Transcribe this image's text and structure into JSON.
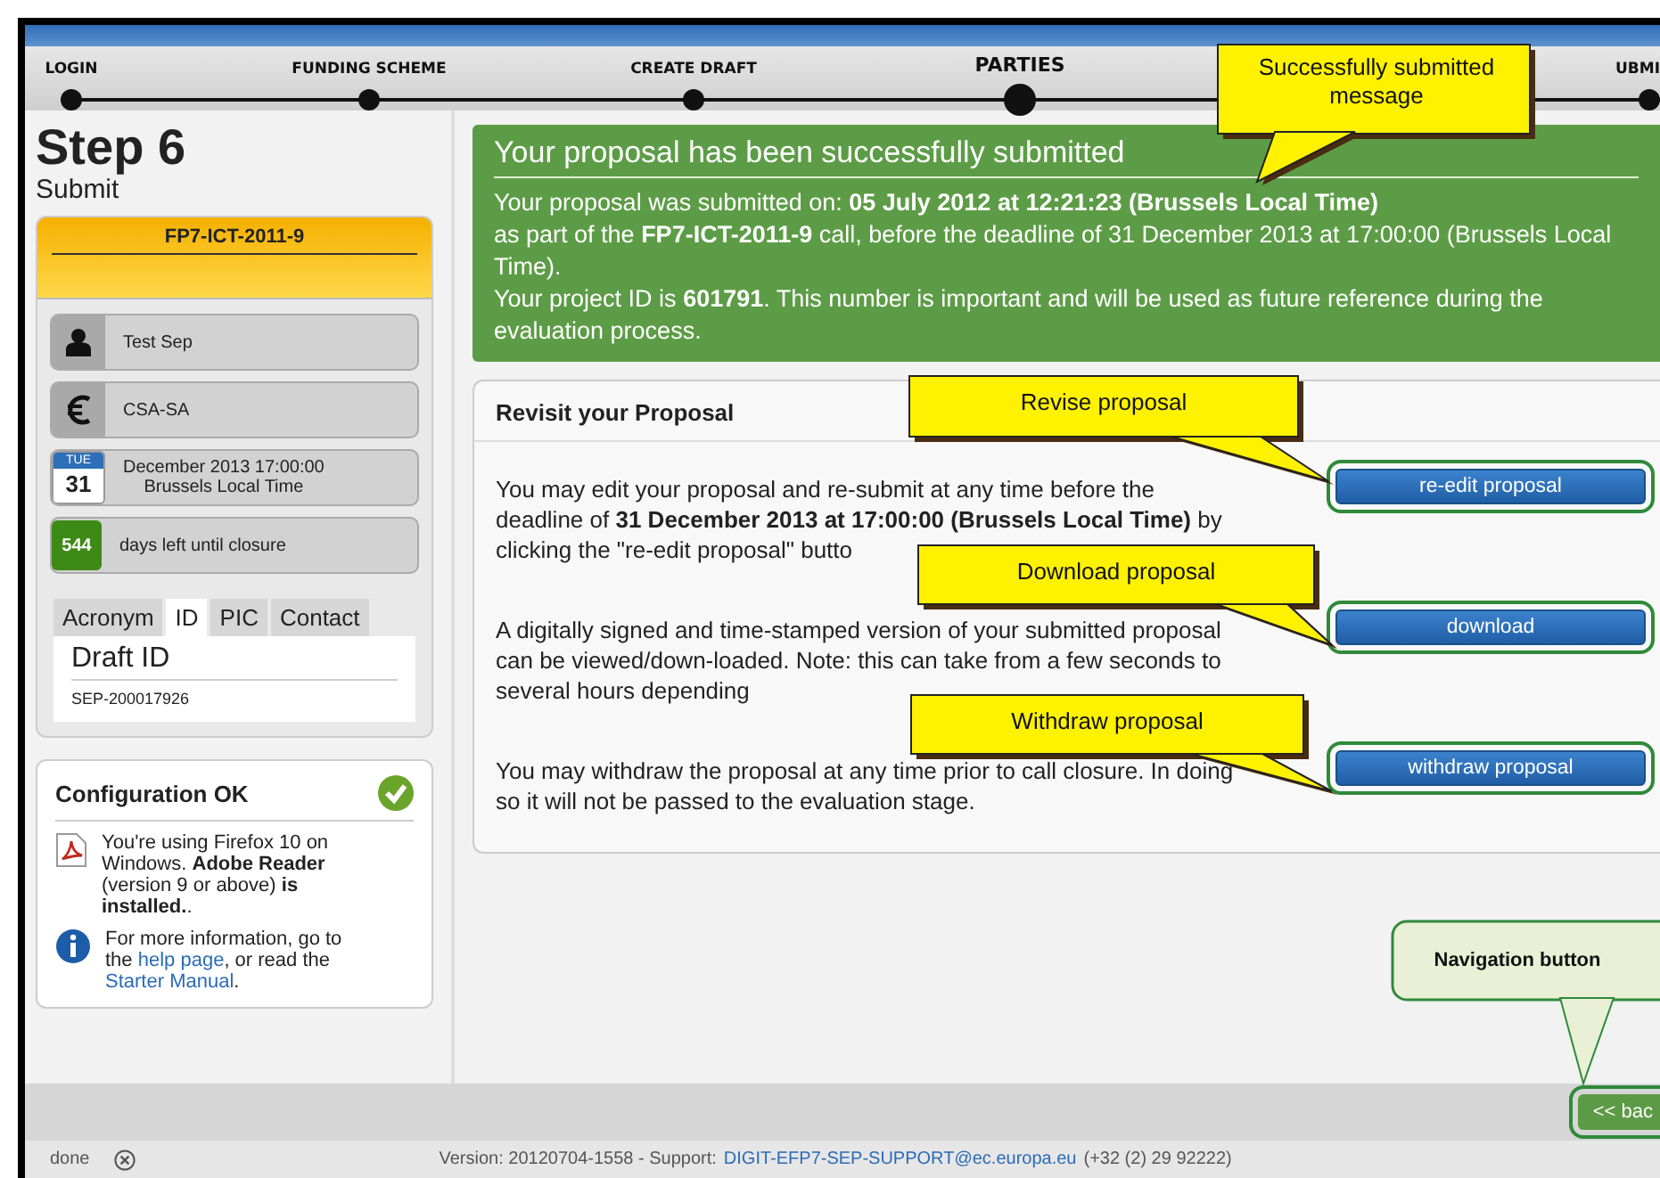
{
  "steps": [
    {
      "label": "LOGIN",
      "selected": false
    },
    {
      "label": "FUNDING SCHEME",
      "selected": false
    },
    {
      "label": "CREATE DRAFT",
      "selected": false
    },
    {
      "label": "PARTIES",
      "selected": true
    },
    {
      "label": "UBMI",
      "selected": false
    }
  ],
  "sidebar": {
    "title": "Step 6",
    "subtitle": "Submit",
    "call": "FP7-ICT-2011-9",
    "info_rows": [
      {
        "kind": "person",
        "lines": [
          "Test Sep"
        ]
      },
      {
        "kind": "currency",
        "lines": [
          "CSA-SA"
        ]
      },
      {
        "kind": "date",
        "day": "TUE",
        "date": "31",
        "lines": [
          "December 2013 17:00:00",
          "Brussels Local Time"
        ]
      },
      {
        "kind": "countdown",
        "badge": "544",
        "lines": [
          "days left until closure"
        ]
      }
    ],
    "tabs": [
      {
        "label": "Acronym",
        "selected": false
      },
      {
        "label": "ID",
        "selected": true
      },
      {
        "label": "PIC",
        "selected": false
      },
      {
        "label": "Contact",
        "selected": false
      }
    ],
    "tab_panel": {
      "heading": "Draft ID",
      "value": "SEP-200017926"
    },
    "config": {
      "title": "Configuration OK",
      "ok": true,
      "items": [
        {
          "kind": "pdf",
          "segments": [
            {
              "text": "You're using Firefox 10 on Windows. **Adobe Reader** (version 9 or above) **is installed.**."
            }
          ]
        },
        {
          "kind": "info",
          "segments": [
            {
              "text": "For more information, go to the "
            },
            {
              "text": "help page",
              "link": true
            },
            {
              "text": ", or read the "
            },
            {
              "text": "Starter Manual",
              "link": true
            },
            {
              "text": "."
            }
          ]
        }
      ]
    }
  },
  "success": {
    "title": "Your proposal has been successfully submitted",
    "paragraphs": [
      "Your proposal was submitted on: **05 July 2012 at 12:21:23 (Brussels Local Time)**",
      "as part of the **FP7-ICT-2011-9** call, before the deadline of 31 December 2013 at 17:00:00 (Brussels Local Time).",
      "Your project ID is **601791**. This number is important and will be used as future reference during the evaluation process."
    ]
  },
  "revisit": {
    "title": "Revisit your Proposal",
    "rows": [
      {
        "text": "You may edit your proposal and re-submit at any time before the deadline of **31 December 2013 at 17:00:00 (Brussels Local Time)** by clicking the \"re-edit proposal\" butto",
        "button": "re-edit proposal"
      },
      {
        "text": "A digitally signed and time-stamped version of your submitted proposal can be viewed/down-loaded. Note: this can take from a few seconds to several hours depending",
        "button": "download"
      },
      {
        "text": "You may withdraw the proposal at any time prior to call closure. In doing so it will not be passed to the evaluation stage.",
        "button": "withdraw proposal"
      }
    ]
  },
  "callouts": [
    {
      "kind": "yellow",
      "text": "Successfully submitted message"
    },
    {
      "kind": "yellow",
      "text": "Revise  proposal"
    },
    {
      "kind": "yellow",
      "text": "Download  proposal"
    },
    {
      "kind": "yellow",
      "text": "Withdraw proposal"
    },
    {
      "kind": "green",
      "text": "Navigation button"
    }
  ],
  "nav": {
    "back": "<< bac"
  },
  "status_bar": {
    "state": "done",
    "version": "Version: 20120704-1558 - Support:",
    "email": "DIGIT-EFP7-SEP-SUPPORT@ec.europa.eu",
    "phone": "(+32 (2) 29 92222)"
  }
}
